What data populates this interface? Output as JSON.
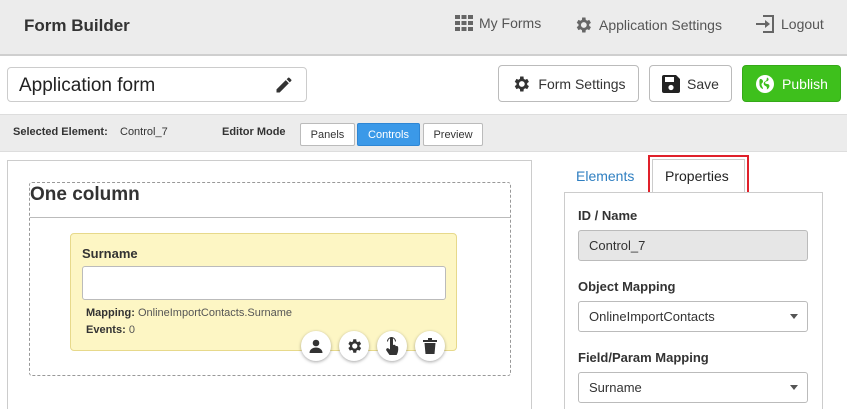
{
  "header": {
    "brand": "Form Builder",
    "nav": [
      {
        "label": "My Forms",
        "icon": "grid-icon"
      },
      {
        "label": "Application Settings",
        "icon": "gear-icon"
      },
      {
        "label": "Logout",
        "icon": "logout-icon"
      }
    ]
  },
  "toolbar": {
    "form_title": "Application form",
    "form_settings_label": "Form Settings",
    "save_label": "Save",
    "publish_label": "Publish",
    "publish_color": "#3ec01c"
  },
  "status": {
    "selected_label": "Selected Element:",
    "selected_value": "Control_7",
    "mode_label": "Editor Mode",
    "modes": [
      "Panels",
      "Controls",
      "Preview"
    ],
    "active_mode": "Controls",
    "active_color": "#3b99e8"
  },
  "canvas": {
    "panel_title": "One column",
    "control": {
      "label": "Surname",
      "input_value": "",
      "mapping_label": "Mapping:",
      "mapping_value": "OnlineImportContacts.Surname",
      "events_label": "Events:",
      "events_value": "0",
      "actions": [
        "user-icon",
        "gear-icon",
        "touch-icon",
        "trash-icon"
      ]
    }
  },
  "properties": {
    "tabs": [
      "Elements",
      "Properties"
    ],
    "active_tab": "Properties",
    "highlight_color": "#e0202a",
    "id_label": "ID / Name",
    "id_value": "Control_7",
    "object_mapping_label": "Object Mapping",
    "object_mapping_value": "OnlineImportContacts",
    "field_mapping_label": "Field/Param Mapping",
    "field_mapping_value": "Surname"
  }
}
